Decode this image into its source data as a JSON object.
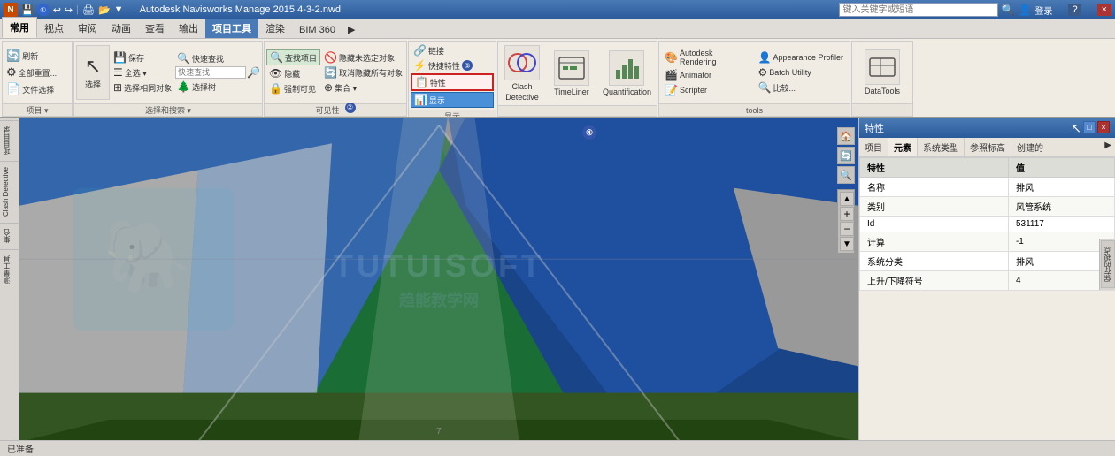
{
  "titlebar": {
    "title": "Autodesk Navisworks Manage 2015  4-3-2.nwd",
    "search_placeholder": "键入关键字或短语",
    "icon": "N",
    "minimize": "−",
    "maximize": "□",
    "close": "×",
    "help": "?",
    "sign_in": "登录"
  },
  "quickaccess": {
    "buttons": [
      "💾",
      "↩",
      "↪",
      "📋",
      "▷"
    ]
  },
  "ribbon_tabs": [
    {
      "label": "常用",
      "active": true
    },
    {
      "label": "视点"
    },
    {
      "label": "审阅"
    },
    {
      "label": "动画"
    },
    {
      "label": "查看"
    },
    {
      "label": "输出"
    },
    {
      "label": "项目工具",
      "active_tab": true
    },
    {
      "label": "渲染"
    },
    {
      "label": "BIM 360"
    },
    {
      "label": "▶"
    }
  ],
  "ribbon_groups": [
    {
      "name": "项目",
      "label": "项目 ▾",
      "buttons": [
        {
          "icon": "🔄",
          "label": "刷新"
        },
        {
          "icon": "⚙",
          "label": "全部重置..."
        },
        {
          "icon": "📄",
          "label": "文件选择"
        }
      ]
    },
    {
      "name": "选择和搜索",
      "label": "选择和搜索 ▾",
      "buttons": [
        {
          "icon": "↖",
          "label": "选择"
        },
        {
          "icon": "💾",
          "label": "保存"
        },
        {
          "icon": "☰",
          "label": "全选 ▾"
        },
        {
          "icon": "⊞",
          "label": "选择相同对象"
        },
        {
          "icon": "🔍",
          "label": "快速查找"
        },
        {
          "icon": "🌲",
          "label": "选择树"
        }
      ]
    },
    {
      "name": "可见性",
      "label": "可见性",
      "buttons": [
        {
          "icon": "🔍",
          "label": "查找项目"
        },
        {
          "icon": "👁",
          "label": "隐藏"
        },
        {
          "icon": "🔒",
          "label": "强制可见"
        },
        {
          "icon": "🚫",
          "label": "隐藏未选定对象"
        },
        {
          "icon": "🔄",
          "label": "取消隐藏所有对象"
        },
        {
          "icon": "⊕",
          "label": "集合 ▾"
        }
      ]
    },
    {
      "name": "显示",
      "label": "显示",
      "buttons": [
        {
          "icon": "🔗",
          "label": "链接"
        },
        {
          "icon": "⚡",
          "label": "快捷特性"
        },
        {
          "icon": "📋",
          "label": "特性",
          "highlighted": true
        },
        {
          "icon": "📊",
          "label": "显示",
          "active": true
        }
      ]
    },
    {
      "name": "clash_detective",
      "label": "Clash Detective",
      "icon": "⚡"
    },
    {
      "name": "timeliner",
      "label": "TimeLiner",
      "icon": "📅"
    },
    {
      "name": "quantification",
      "label": "Quantification",
      "icon": "📊"
    },
    {
      "name": "tools",
      "label": "工具",
      "items": [
        {
          "icon": "🎨",
          "label": "Autodesk Rendering"
        },
        {
          "icon": "👤",
          "label": "Appearance Profiler"
        },
        {
          "icon": "🎬",
          "label": "Animator"
        },
        {
          "icon": "⚙",
          "label": "Batch Utility"
        },
        {
          "icon": "📝",
          "label": "Scripter"
        },
        {
          "icon": "🔍",
          "label": "比较..."
        }
      ]
    },
    {
      "name": "datatools",
      "label": "DataTools",
      "icon": "📊"
    }
  ],
  "properties_panel": {
    "title": "特性",
    "tabs": [
      {
        "label": "项目",
        "active": false
      },
      {
        "label": "元素",
        "active": true
      },
      {
        "label": "系统类型",
        "active": false
      },
      {
        "label": "参照标高",
        "active": false
      },
      {
        "label": "创建的",
        "active": false
      }
    ],
    "headers": [
      "特性",
      "值"
    ],
    "rows": [
      {
        "property": "名称",
        "value": "排风"
      },
      {
        "property": "类别",
        "value": "风管系统"
      },
      {
        "property": "Id",
        "value": "531117"
      },
      {
        "property": "计算",
        "value": "-1"
      },
      {
        "property": "系统分类",
        "value": "排风"
      },
      {
        "property": "上升/下降符号",
        "value": "4"
      }
    ]
  },
  "left_nav": {
    "items": [
      "项目目录",
      "Clash Detective",
      "集合",
      "测量工具"
    ]
  },
  "annotations": [
    {
      "id": "1",
      "label": "1"
    },
    {
      "id": "2",
      "label": "2"
    },
    {
      "id": "3",
      "label": "3"
    },
    {
      "id": "4",
      "label": "4"
    }
  ],
  "watermark": {
    "line1": "TUTUISOFT",
    "line2": "趋能教学网"
  },
  "status": {
    "text": "已准备"
  }
}
